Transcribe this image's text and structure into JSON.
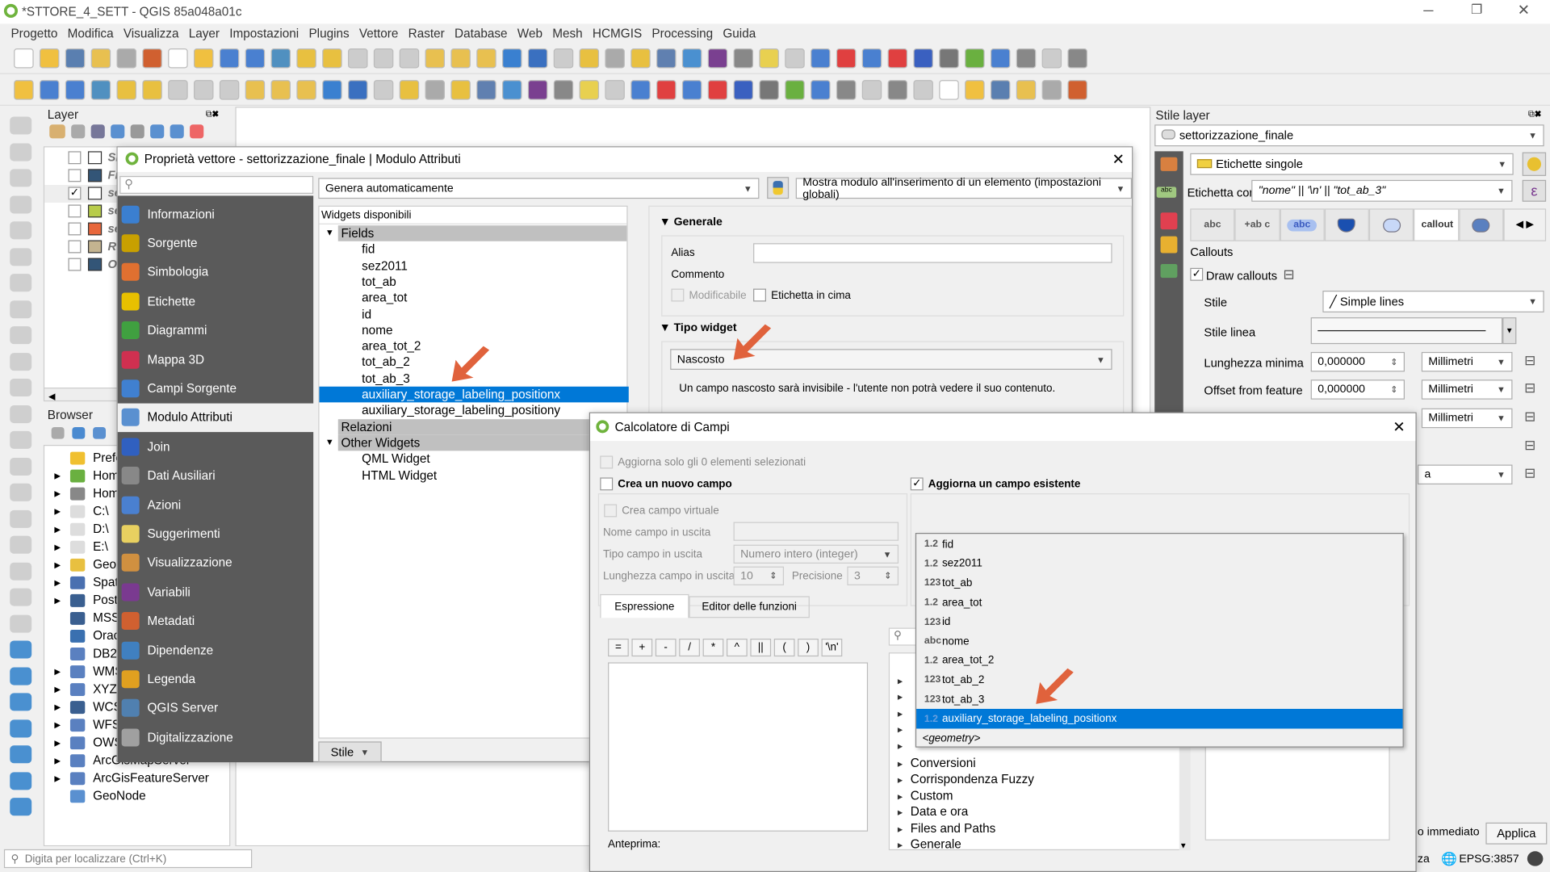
{
  "window": {
    "title": "*STTORE_4_SETT - QGIS 85a048a01c"
  },
  "menu": [
    "Progetto",
    "Modifica",
    "Visualizza",
    "Layer",
    "Impostazioni",
    "Plugins",
    "Vettore",
    "Raster",
    "Database",
    "Web",
    "Mesh",
    "HCMGIS",
    "Processing",
    "Guida"
  ],
  "layers_panel": {
    "title": "Layer",
    "layers": [
      {
        "name": "Sl",
        "checked": false,
        "swatch": "#ffffff"
      },
      {
        "name": "Fi",
        "checked": false,
        "swatch": "#335577"
      },
      {
        "name": "se",
        "checked": true,
        "swatch": "#ffffff"
      },
      {
        "name": "se",
        "checked": false,
        "swatch": "#b8cc4a"
      },
      {
        "name": "se",
        "checked": false,
        "swatch": "#e8673c"
      },
      {
        "name": "R",
        "checked": false,
        "swatch": "#c4b490"
      },
      {
        "name": "O",
        "checked": false,
        "swatch": "#335577"
      }
    ]
  },
  "browser_panel": {
    "title": "Browser",
    "items": [
      "Prefe",
      "Hom",
      "Hom",
      "C:\\",
      "D:\\",
      "E:\\",
      "GeoP",
      "Spati",
      "PostG",
      "MSSG",
      "Oracl",
      "DB2",
      "WMS",
      "XYZ",
      "WCS",
      "WFS",
      "OWS",
      "ArcGisMapServer",
      "ArcGisFeatureServer",
      "GeoNode"
    ]
  },
  "locator": {
    "placeholder": "Digita per localizzare (Ctrl+K)"
  },
  "props_dialog": {
    "title": "Proprietà vettore - settorizzazione_finale | Modulo Attributi",
    "nav": [
      "Informazioni",
      "Sorgente",
      "Simbologia",
      "Etichette",
      "Diagrammi",
      "Mappa 3D",
      "Campi Sorgente",
      "Modulo Attributi",
      "Join",
      "Dati Ausiliari",
      "Azioni",
      "Suggerimenti",
      "Visualizzazione",
      "Variabili",
      "Metadati",
      "Dipendenze",
      "Legenda",
      "QGIS Server",
      "Digitalizzazione"
    ],
    "nav_colors": [
      "#3b7fd0",
      "#c8a000",
      "#e07030",
      "#e8c000",
      "#40a040",
      "#d03050",
      "#4080d0",
      "#5a90d0",
      "#3060c0",
      "#888888",
      "#4a80d0",
      "#e8d060",
      "#d09040",
      "#7a3a90",
      "#d06030",
      "#4080c0",
      "#e0a020",
      "#5080b0",
      "#a0a0a0"
    ],
    "selected_nav": "Modulo Attributi",
    "layout_combo": "Genera automaticamente",
    "show_form_combo": "Mostra modulo all'inserimento di un elemento (impostazioni globali)",
    "widgets_header": "Widgets disponibili",
    "tree": {
      "fields_label": "Fields",
      "fields": [
        "fid",
        "sez2011",
        "tot_ab",
        "area_tot",
        "id",
        "nome",
        "area_tot_2",
        "tot_ab_2",
        "tot_ab_3",
        "auxiliary_storage_labeling_positionx",
        "auxiliary_storage_labeling_positiony"
      ],
      "selected": "auxiliary_storage_labeling_positionx",
      "relations_label": "Relazioni",
      "other_label": "Other Widgets",
      "other": [
        "QML Widget",
        "HTML Widget"
      ]
    },
    "style_button": "Stile",
    "general": {
      "header": "Generale",
      "alias_label": "Alias",
      "alias_value": "",
      "comment_label": "Commento",
      "editable_label": "Modificabile",
      "label_on_top": "Etichetta in cima"
    },
    "widget_type": {
      "header": "Tipo widget",
      "value": "Nascosto",
      "description": "Un campo nascosto sarà invisibile - l'utente non potrà vedere il suo contenuto."
    }
  },
  "field_calc": {
    "title": "Calcolatore di Campi",
    "only_selected": "Aggiorna solo gli 0 elementi selezionati",
    "create_new": "Crea un nuovo campo",
    "create_new_checked": false,
    "update_existing": "Aggiorna un campo esistente",
    "update_existing_checked": true,
    "virtual": "Crea campo virtuale",
    "out_name_label": "Nome campo in uscita",
    "out_name_value": "",
    "out_type_label": "Tipo campo in uscita",
    "out_type_value": "Numero intero (integer)",
    "out_len_label": "Lunghezza campo in uscita",
    "out_len_value": "10",
    "precision_label": "Precisione",
    "precision_value": "3",
    "tabs": [
      "Espressione",
      "Editor delle funzioni"
    ],
    "operators": [
      "=",
      "+",
      "-",
      "/",
      "*",
      "^",
      "||",
      "(",
      ")",
      "'\\n'"
    ],
    "preview_label": "Anteprima:",
    "function_groups": [
      "Conversioni",
      "Corrispondenza Fuzzy",
      "Custom",
      "Data e ora",
      "Files and Paths",
      "Generale"
    ],
    "field_dropdown": [
      {
        "type": "1.2",
        "name": "fid"
      },
      {
        "type": "1.2",
        "name": "sez2011"
      },
      {
        "type": "123",
        "name": "tot_ab"
      },
      {
        "type": "1.2",
        "name": "area_tot"
      },
      {
        "type": "123",
        "name": "id"
      },
      {
        "type": "abc",
        "name": "nome"
      },
      {
        "type": "1.2",
        "name": "area_tot_2"
      },
      {
        "type": "123",
        "name": "tot_ab_2"
      },
      {
        "type": "123",
        "name": "tot_ab_3"
      },
      {
        "type": "1.2",
        "name": "auxiliary_storage_labeling_positionx"
      }
    ],
    "dropdown_selected": "auxiliary_storage_labeling_positionx",
    "geometry_item": "<geometry>"
  },
  "style_panel": {
    "title": "Stile layer",
    "layer": "settorizzazione_finale",
    "renderer": "Etichette singole",
    "label_with_label": "Etichetta con",
    "label_expression": "\"nome\"  ||  '\\n'  ||  \"tot_ab_3\"",
    "tabs": [
      "abc",
      "+ab c",
      "abc",
      "shield",
      "bg",
      "callout",
      "placement"
    ],
    "callouts_header": "Callouts",
    "draw_callouts": "Draw callouts",
    "draw_callouts_checked": true,
    "style_label": "Stile",
    "style_value": "Simple lines",
    "line_style_label": "Stile linea",
    "min_length_label": "Lunghezza minima",
    "min_length_value": "0,000000",
    "min_length_unit": "Millimetri",
    "offset_label": "Offset from feature",
    "offset_value": "0,000000",
    "offset_unit": "Millimetri",
    "third_unit": "Millimetri",
    "live_update": "o immediato",
    "apply": "Applica"
  },
  "status": {
    "crs": "EPSG:3857",
    "partial": "za"
  },
  "colors": {
    "accent": "#0078d7",
    "nav_bg": "#5a5a5a",
    "arrow": "#e0623c"
  }
}
